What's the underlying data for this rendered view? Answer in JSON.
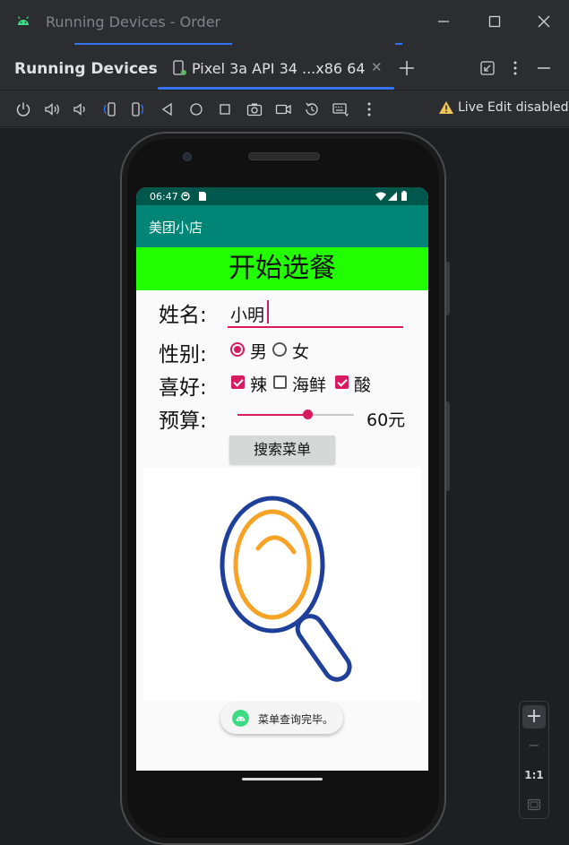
{
  "window": {
    "title": "Running Devices - Order"
  },
  "tool_window": {
    "title": "Running Devices",
    "tab_label": "Pixel 3a API 34 ...x86 64"
  },
  "device_toolbar": {
    "icons": [
      "power-icon",
      "volume-up-icon",
      "volume-down-icon",
      "rotate-left-icon",
      "rotate-right-icon",
      "back-icon",
      "home-icon",
      "overview-icon",
      "screenshot-icon",
      "screen-record-icon",
      "reset-icon",
      "keyboard-icon",
      "more-icon"
    ],
    "live_edit_label": "Live Edit disabled"
  },
  "device": {
    "status_time": "06:47",
    "app_title": "美团小店",
    "hero_text": "开始选餐",
    "form": {
      "name_label": "姓名:",
      "name_value": "小明",
      "gender_label": "性别:",
      "gender_options": [
        {
          "label": "男",
          "selected": true
        },
        {
          "label": "女",
          "selected": false
        }
      ],
      "hobby_label": "喜好:",
      "hobby_options": [
        {
          "label": "辣",
          "checked": true
        },
        {
          "label": "海鲜",
          "checked": false
        },
        {
          "label": "酸",
          "checked": true
        }
      ],
      "budget_label": "预算:",
      "budget_value_text": "60元",
      "budget_slider_fraction": 0.6
    },
    "search_button_label": "搜索菜单",
    "toast_text": "菜单查询完毕。"
  },
  "zoom_controls": {
    "zoom_in_label": "+",
    "zoom_out_label": "−",
    "actual_size_label": "1:1"
  },
  "colors": {
    "accent": "#d81b60",
    "app_bar": "#008577",
    "status_bar": "#00574b",
    "hero_bg": "#22ff00",
    "ide_accent": "#3574f0"
  }
}
